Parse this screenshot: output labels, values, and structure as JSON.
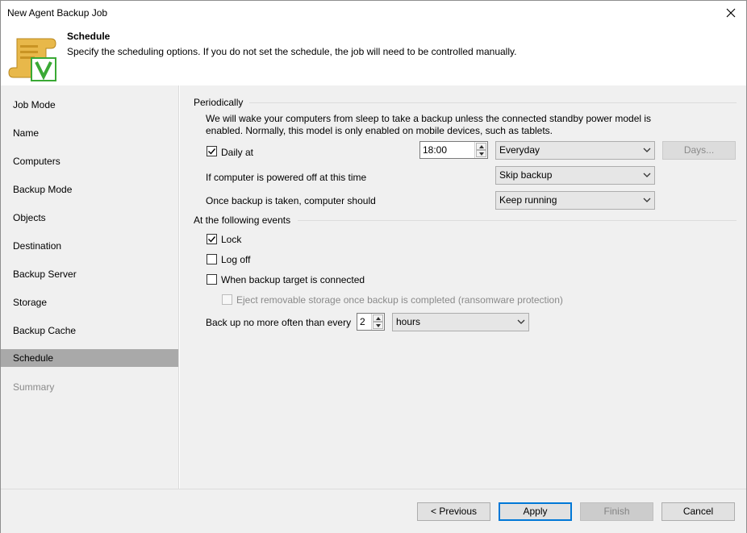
{
  "window": {
    "title": "New Agent Backup Job"
  },
  "header": {
    "title": "Schedule",
    "description": "Specify the scheduling options. If you do not set the schedule, the job will need to be controlled manually."
  },
  "sidebar": {
    "items": [
      {
        "label": "Job Mode",
        "state": "normal"
      },
      {
        "label": "Name",
        "state": "normal"
      },
      {
        "label": "Computers",
        "state": "normal"
      },
      {
        "label": "Backup Mode",
        "state": "normal"
      },
      {
        "label": "Objects",
        "state": "normal"
      },
      {
        "label": "Destination",
        "state": "normal"
      },
      {
        "label": "Backup Server",
        "state": "normal"
      },
      {
        "label": "Storage",
        "state": "normal"
      },
      {
        "label": "Backup Cache",
        "state": "normal"
      },
      {
        "label": "Schedule",
        "state": "active"
      },
      {
        "label": "Summary",
        "state": "disabled"
      }
    ]
  },
  "periodically": {
    "label": "Periodically",
    "note_line1": "We will wake your computers from sleep to take a backup unless the connected standby power model is",
    "note_line2": "enabled. Normally, this model is only enabled on mobile devices, such as tablets.",
    "daily_at": {
      "label": "Daily at",
      "checked": true,
      "time": "18:00",
      "frequency": "Everyday",
      "days_button": "Days..."
    },
    "powered_off": {
      "label": "If computer is powered off at this time",
      "value": "Skip backup"
    },
    "after_backup": {
      "label": "Once backup is taken, computer should",
      "value": "Keep running"
    }
  },
  "events": {
    "label": "At the following events",
    "lock": {
      "label": "Lock",
      "checked": true
    },
    "logoff": {
      "label": "Log off",
      "checked": false
    },
    "target_connected": {
      "label": "When backup target is connected",
      "checked": false
    },
    "eject": {
      "label": "Eject removable storage once backup is completed (ransomware protection)",
      "checked": false,
      "enabled": false
    },
    "no_more_often": {
      "label": "Back up no more often than every",
      "value": "2",
      "unit": "hours"
    }
  },
  "footer": {
    "previous": "< Previous",
    "apply": "Apply",
    "finish": "Finish",
    "cancel": "Cancel"
  },
  "icons": {
    "close": "close-icon",
    "logo": "veeam-schedule-logo-icon",
    "dropdown": "chevron-down-icon",
    "check": "checkmark-icon"
  },
  "colors": {
    "sidebar_active": "#a9a9a9",
    "panel_background": "#f0f0f0",
    "primary_button_border": "#0078d7",
    "logo_gold": "#e8b84a",
    "logo_green": "#3aa935"
  }
}
